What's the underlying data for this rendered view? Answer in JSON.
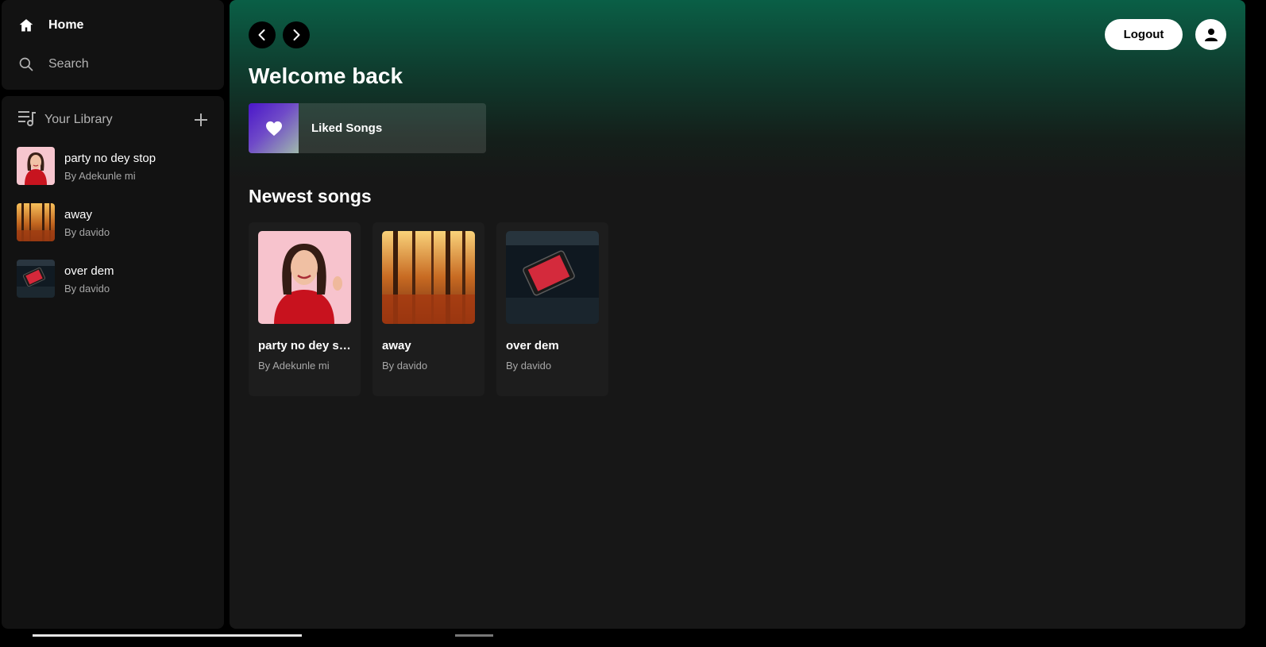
{
  "sidebar": {
    "nav": {
      "home_label": "Home",
      "search_label": "Search"
    },
    "library": {
      "title": "Your Library",
      "items": [
        {
          "title": "party no dey stop",
          "author": "By Adekunle mi"
        },
        {
          "title": "away",
          "author": "By davido"
        },
        {
          "title": "over dem",
          "author": "By davido"
        }
      ]
    }
  },
  "header": {
    "logout_label": "Logout"
  },
  "main": {
    "welcome": "Welcome back",
    "liked_songs_label": "Liked Songs",
    "newest_title": "Newest songs",
    "cards": [
      {
        "title": "party no dey stop",
        "author": "By Adekunle mi"
      },
      {
        "title": "away",
        "author": "By davido"
      },
      {
        "title": "over dem",
        "author": "By davido"
      }
    ]
  },
  "colors": {
    "accent_green": "#0a5f46",
    "background": "#121212",
    "main_background": "#171717"
  }
}
